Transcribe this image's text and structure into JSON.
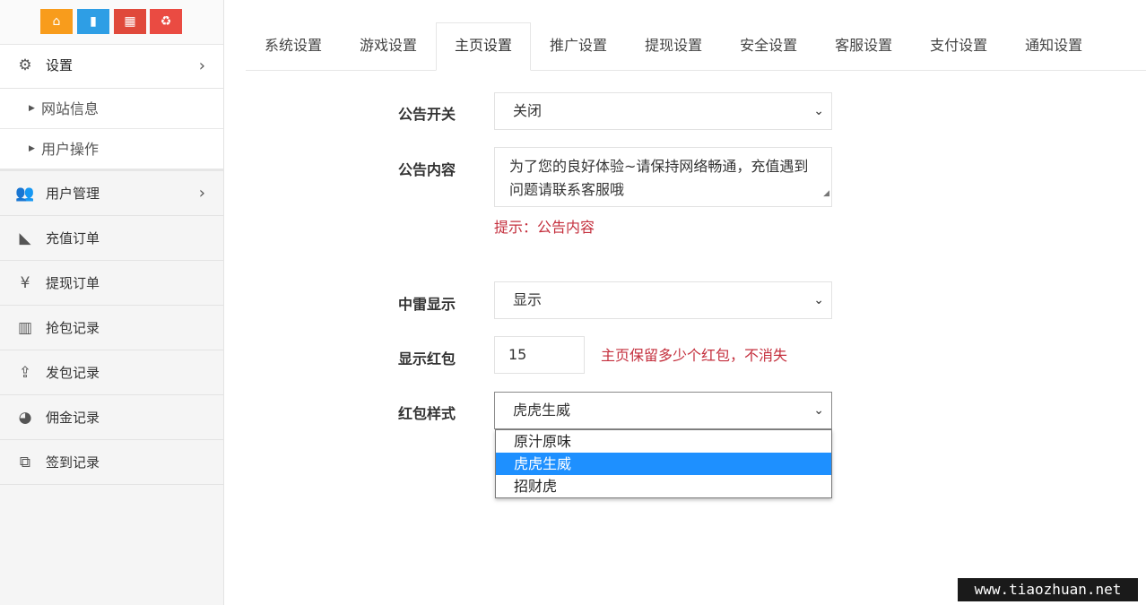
{
  "sidebar": {
    "shortcuts": [
      {
        "icon": "home-icon",
        "color": "#f89c1c"
      },
      {
        "icon": "document-icon",
        "color": "#2e9ee5"
      },
      {
        "icon": "trash-icon",
        "color": "#e0493b"
      },
      {
        "icon": "recycle-icon",
        "color": "#ea4b42"
      }
    ],
    "settings": {
      "label": "设置",
      "icon": "gears-icon"
    },
    "sub_items": [
      {
        "label": "网站信息"
      },
      {
        "label": "用户操作"
      }
    ],
    "items": [
      {
        "label": "用户管理",
        "icon": "users-icon"
      },
      {
        "label": "充值订单",
        "icon": "area-chart-icon"
      },
      {
        "label": "提现订单",
        "icon": "yen-icon"
      },
      {
        "label": "抢包记录",
        "icon": "bar-chart-icon"
      },
      {
        "label": "发包记录",
        "icon": "upload-icon"
      },
      {
        "label": "佣金记录",
        "icon": "pie-chart-icon"
      },
      {
        "label": "签到记录",
        "icon": "clone-icon"
      }
    ]
  },
  "tabs": [
    {
      "label": "系统设置"
    },
    {
      "label": "游戏设置"
    },
    {
      "label": "主页设置",
      "active": true
    },
    {
      "label": "推广设置"
    },
    {
      "label": "提现设置"
    },
    {
      "label": "安全设置"
    },
    {
      "label": "客服设置"
    },
    {
      "label": "支付设置"
    },
    {
      "label": "通知设置"
    }
  ],
  "form": {
    "notice_switch": {
      "label": "公告开关",
      "value": "关闭"
    },
    "notice_content": {
      "label": "公告内容",
      "value": "为了您的良好体验~请保持网络畅通，充值遇到问题请联系客服哦",
      "hint": "提示：公告内容"
    },
    "show_mine": {
      "label": "中雷显示",
      "value": "显示"
    },
    "show_packets": {
      "label": "显示红包",
      "value": "15",
      "hint": "主页保留多少个红包，不消失"
    },
    "packet_style": {
      "label": "红包样式",
      "value": "虎虎生威",
      "options": [
        "原汁原味",
        "虎虎生威",
        "招财虎"
      ]
    }
  },
  "watermark": "www.tiaozhuan.net",
  "colors": {
    "hint": "#c42f3d",
    "selected_option": "#1e90ff"
  }
}
